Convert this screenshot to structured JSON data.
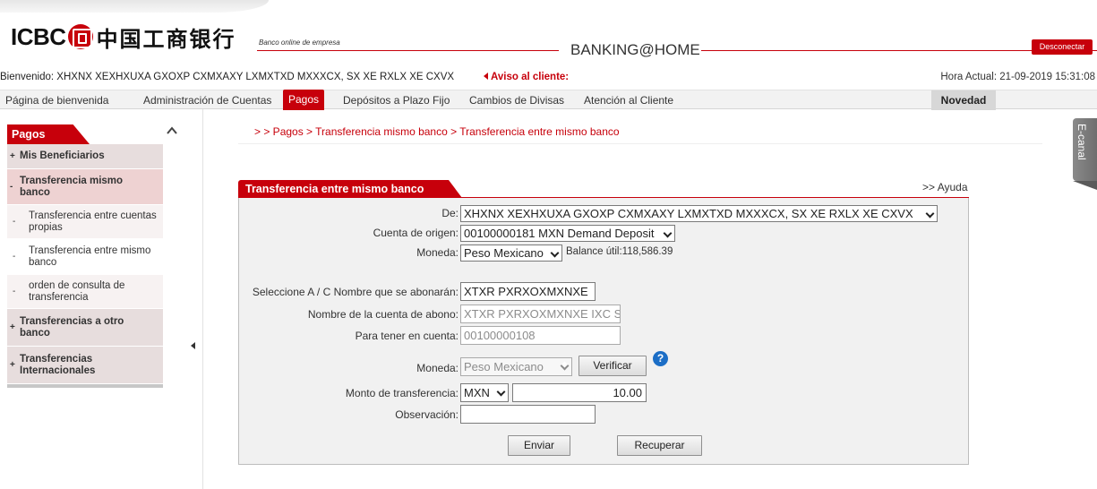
{
  "header": {
    "logo_text": "ICBC",
    "logo_cn": "中国工商银行",
    "tagline": "Banco online de empresa",
    "title": "BANKING@HOME",
    "logout_label": "Desconectar"
  },
  "welcome": {
    "text": "Bienvenido: XHXNX XEXHXUXA GXOXP CXMXAXY LXMXTXD MXXXCX, SX XE RXLX XE CXVX",
    "notice": "Aviso al cliente:",
    "time": "Hora Actual: 21-09-2019 15:31:08"
  },
  "nav": {
    "items": [
      {
        "label": "Página de bienvenida"
      },
      {
        "label": "Administración de Cuentas"
      },
      {
        "label": "Pagos"
      },
      {
        "label": "Depósitos a Plazo Fijo"
      },
      {
        "label": "Cambios de Divisas"
      },
      {
        "label": "Atención al Cliente"
      }
    ],
    "novedad": "Novedad"
  },
  "sidebar": {
    "title": "Pagos",
    "items": [
      {
        "mark": "+",
        "label": "Mis Beneficiarios"
      },
      {
        "mark": "-",
        "label": "Transferencia mismo banco"
      },
      {
        "mark": "-",
        "label": "Transferencia entre cuentas propias"
      },
      {
        "mark": "-",
        "label": "Transferencia entre mismo banco"
      },
      {
        "mark": "-",
        "label": "orden de consulta de transferencia"
      },
      {
        "mark": "+",
        "label": "Transferencias a otro banco"
      },
      {
        "mark": "+",
        "label": "Transferencias Internacionales"
      }
    ]
  },
  "breadcrumb": "> > Pagos > Transferencia mismo banco > Transferencia entre mismo banco",
  "ecanal": "E-canal",
  "form": {
    "title": "Transferencia entre mismo banco",
    "help": ">> Ayuda",
    "de_label": "De:",
    "de_value": "XHXNX XEXHXUXA GXOXP CXMXAXY LXMXTXD MXXXCX, SX XE RXLX XE CXVX",
    "origen_label": "Cuenta de origen:",
    "origen_value": "00100000181 MXN Demand Deposit",
    "moneda_label": "Moneda:",
    "moneda_value": "Peso Mexicano",
    "balance": "Balance útil:118,586.39",
    "nombre_label": "Seleccione A / C Nombre que se abonarán:",
    "nombre_value": "XTXR PXRXOXMXNXE",
    "cuenta_abono_label": "Nombre de la cuenta de abono:",
    "cuenta_abono_value": "XTXR PXRXOXMXNXE IXC S",
    "tener_label": "Para tener en cuenta:",
    "tener_value": "00100000108",
    "moneda2_label": "Moneda:",
    "moneda2_value": "Peso Mexicano",
    "verificar": "Verificar",
    "help_icon": "?",
    "monto_label": "Monto de transferencia:",
    "monto_currency": "MXN",
    "monto_value": "10.00",
    "obs_label": "Observación:",
    "obs_value": "",
    "enviar": "Enviar",
    "recuperar": "Recuperar"
  },
  "colors": {
    "brand_red": "#c7000b",
    "help_blue": "#1c6ec6"
  }
}
